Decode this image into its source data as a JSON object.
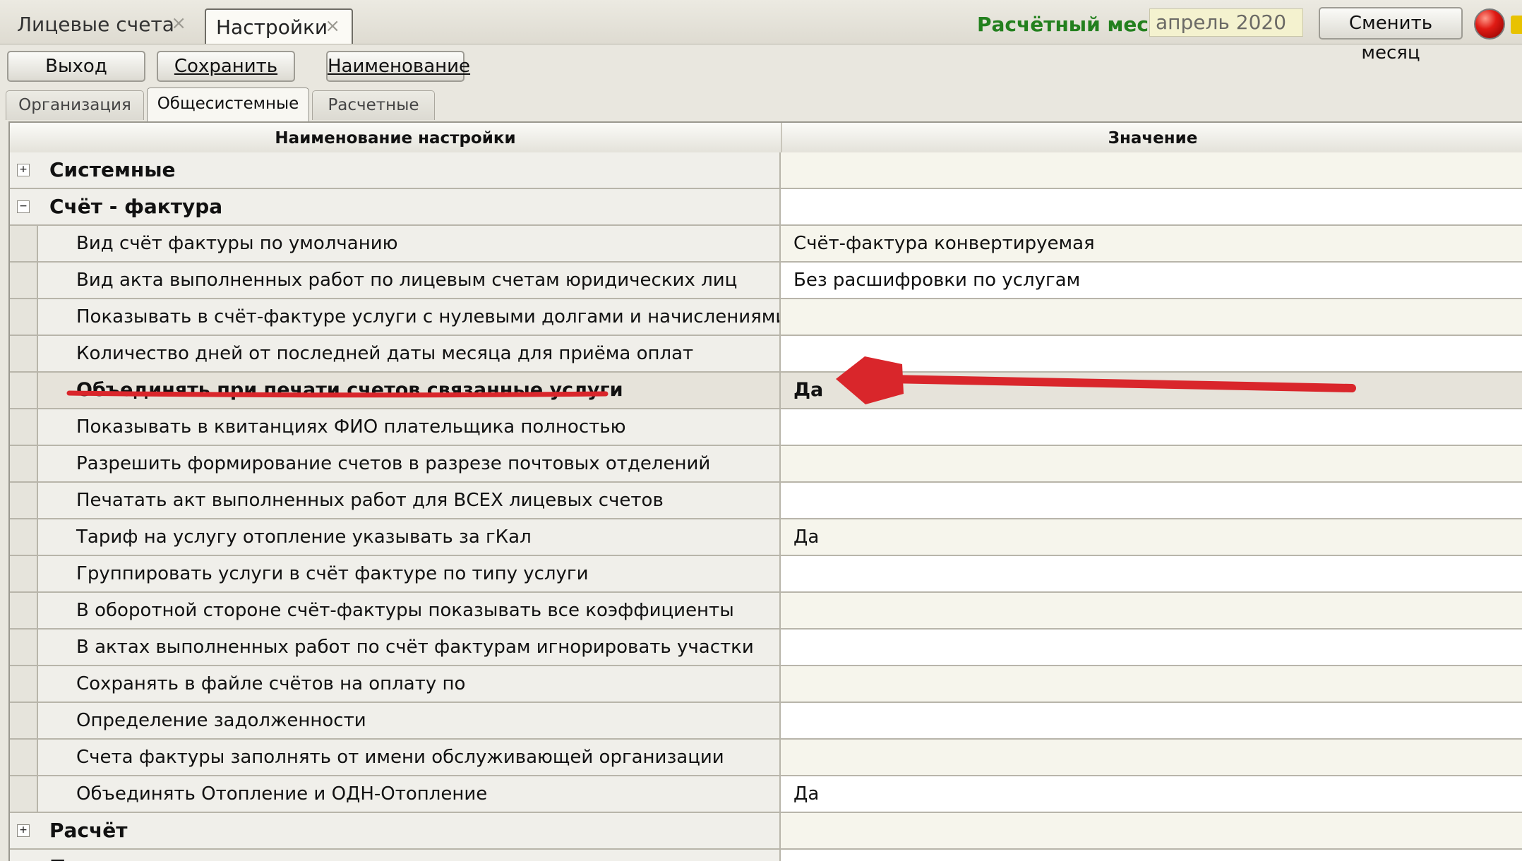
{
  "doc_tabs": [
    {
      "label": "Лицевые счета",
      "close": "×"
    },
    {
      "label": "Настройки",
      "close": "×"
    }
  ],
  "period": {
    "label": "Расчётный месяц",
    "value": "апрель 2020",
    "change_label": "Сменить месяц"
  },
  "toolbar": {
    "exit_label": "Выход",
    "save_label": "Сохранить",
    "name_label": "Наименование"
  },
  "section_tabs": [
    "Организация",
    "Общесистемные",
    "Расчетные"
  ],
  "columns": {
    "name": "Наименование настройки",
    "value": "Значение"
  },
  "rows": [
    {
      "type": "group",
      "toggle": "+",
      "name": "Системные",
      "value": ""
    },
    {
      "type": "group",
      "toggle": "−",
      "name": "Счёт - фактура",
      "value": ""
    },
    {
      "type": "child",
      "name": "Вид счёт фактуры по умолчанию",
      "value": "Счёт-фактура конвертируемая"
    },
    {
      "type": "child",
      "name": "Вид акта выполненных работ по лицевым счетам юридических лиц",
      "value": "Без расшифровки по услугам"
    },
    {
      "type": "child",
      "name": "Показывать в счёт-фактуре услуги с нулевыми долгами и начислениями",
      "value": ""
    },
    {
      "type": "child",
      "name": "Количество дней от последней даты месяца для приёма оплат",
      "value": ""
    },
    {
      "type": "child",
      "name": "Объединять при печати счетов связанные услуги",
      "value": "Да",
      "selected": true
    },
    {
      "type": "child",
      "name": "Показывать в квитанциях ФИО плательщика полностью",
      "value": ""
    },
    {
      "type": "child",
      "name": "Разрешить формирование счетов в разрезе почтовых отделений",
      "value": ""
    },
    {
      "type": "child",
      "name": "Печатать акт выполненных работ для ВСЕХ лицевых счетов",
      "value": ""
    },
    {
      "type": "child",
      "name": "Тариф на услугу отопление указывать за гКал",
      "value": "Да"
    },
    {
      "type": "child",
      "name": "Группировать услуги в счёт фактуре по типу услуги",
      "value": ""
    },
    {
      "type": "child",
      "name": "В оборотной стороне счёт-фактуры показывать все коэффициенты",
      "value": ""
    },
    {
      "type": "child",
      "name": "В актах выполненных работ по счёт фактурам игнорировать участки",
      "value": ""
    },
    {
      "type": "child",
      "name": "Сохранять в файле счётов на оплату по",
      "value": ""
    },
    {
      "type": "child",
      "name": "Определение задолженности",
      "value": ""
    },
    {
      "type": "child",
      "name": "Счета фактуры заполнять от имени обслуживающей организации",
      "value": ""
    },
    {
      "type": "child",
      "name": "Объединять Отопление и ОДН-Отопление",
      "value": "Да"
    },
    {
      "type": "group",
      "toggle": "+",
      "name": "Расчёт",
      "value": ""
    },
    {
      "type": "group",
      "toggle": "+",
      "name": "Поставщики",
      "value": ""
    }
  ],
  "colors": {
    "accent_green": "#23801e",
    "annotation_red": "#d9262b",
    "period_bg": "#f4f2cf"
  },
  "icons": {
    "status": "red-circle-icon",
    "expand": "plus-box-icon",
    "collapse": "minus-box-icon",
    "close": "close-icon"
  }
}
